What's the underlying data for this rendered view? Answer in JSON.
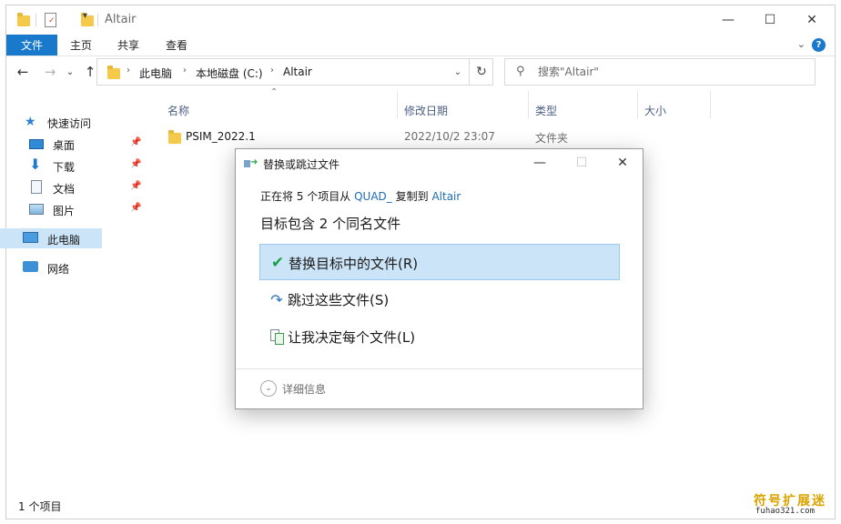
{
  "window": {
    "title": "Altair",
    "controls": {
      "minimize": "—",
      "maximize": "☐",
      "close": "✕"
    }
  },
  "ribbon": {
    "tabs": [
      "文件",
      "主页",
      "共享",
      "查看"
    ],
    "expand": "⌄",
    "help": "?"
  },
  "nav_buttons": {
    "back": "←",
    "forward": "→",
    "recent": "⌄",
    "up": "↑"
  },
  "address": {
    "crumbs": [
      "此电脑",
      "本地磁盘 (C:)",
      "Altair"
    ],
    "separator": "›"
  },
  "search": {
    "placeholder": "搜索\"Altair\""
  },
  "nav_pane": {
    "quick_access": "快速访问",
    "items": [
      {
        "label": "桌面",
        "icon": "desktop-icon",
        "pinned": true
      },
      {
        "label": "下载",
        "icon": "download-icon",
        "pinned": true
      },
      {
        "label": "文档",
        "icon": "document-icon",
        "pinned": true
      },
      {
        "label": "图片",
        "icon": "picture-icon",
        "pinned": true
      }
    ],
    "this_pc": "此电脑",
    "network": "网络"
  },
  "columns": {
    "name": "名称",
    "date": "修改日期",
    "type": "类型",
    "size": "大小"
  },
  "files": [
    {
      "name": "PSIM_2022.1",
      "date": "2022/10/2 23:07",
      "type": "文件夹",
      "size": ""
    }
  ],
  "status": {
    "count": "1 个项目"
  },
  "dialog": {
    "title": "替换或跳过文件",
    "line1_prefix": "正在将 5 个项目从",
    "line1_source": "QUAD_",
    "line1_mid": "复制到",
    "line1_dest": "Altair",
    "line2": "目标包含 2 个同名文件",
    "options": [
      {
        "label": "替换目标中的文件(R)",
        "icon": "check-icon"
      },
      {
        "label": "跳过这些文件(S)",
        "icon": "skip-icon"
      },
      {
        "label": "让我决定每个文件(L)",
        "icon": "compare-icon"
      }
    ],
    "details": "详细信息"
  },
  "watermark": {
    "text": "符号扩展迷",
    "url": "fuhao321.com"
  },
  "colors": {
    "accent": "#1979ca",
    "selection": "#cce4f7",
    "folder": "#f5c94a",
    "link": "#1e6cb8"
  }
}
